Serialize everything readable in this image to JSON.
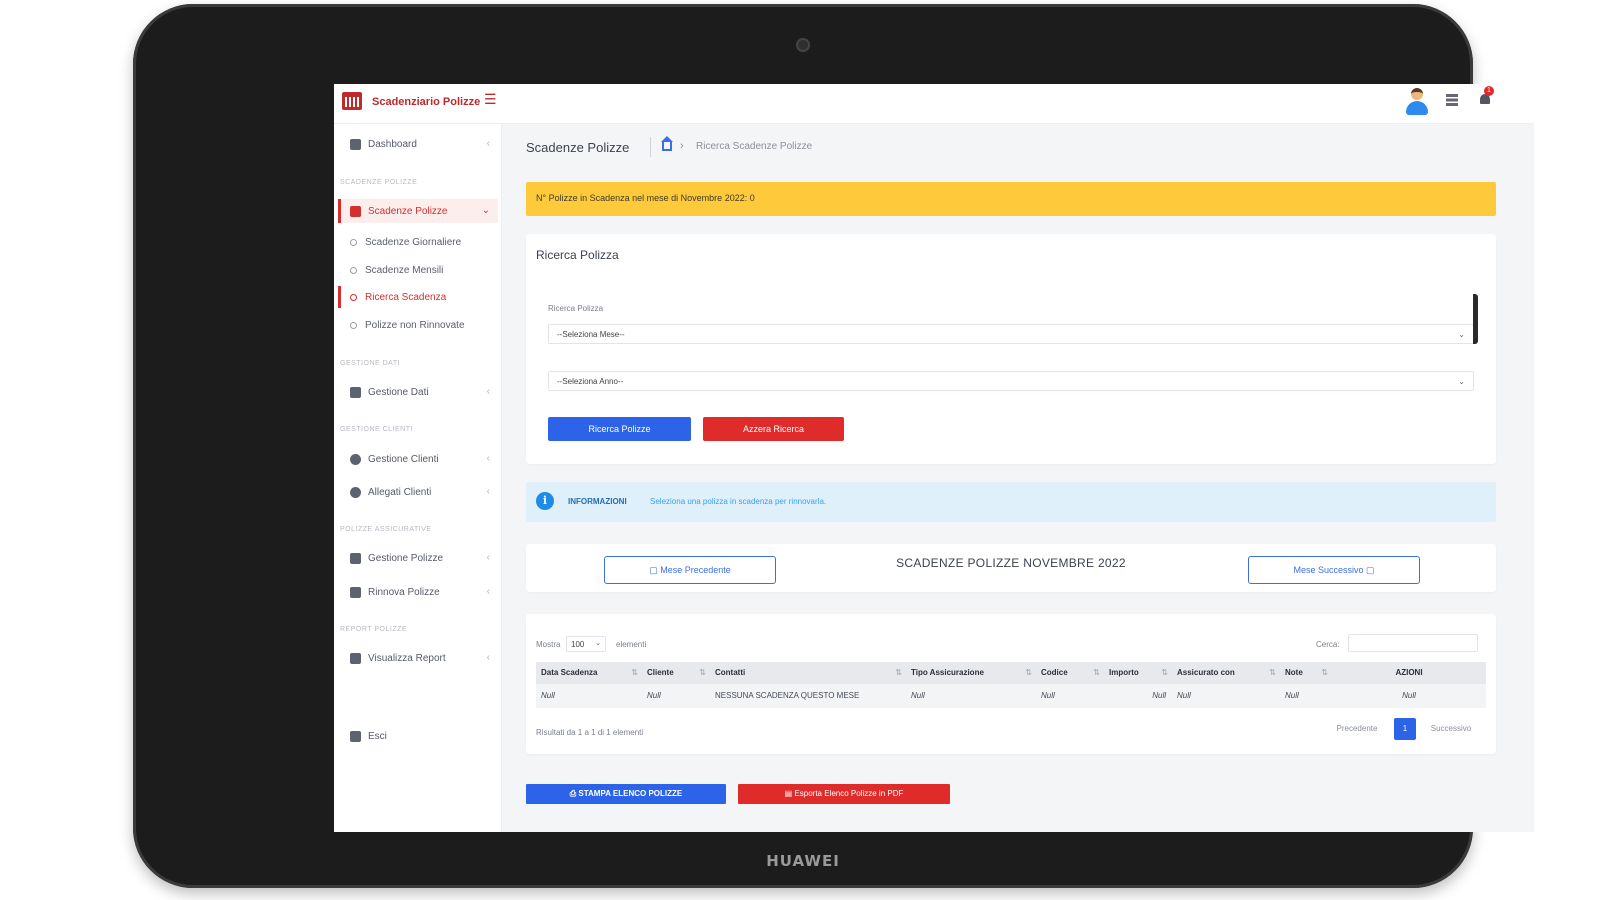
{
  "device": {
    "brand": "HUAWEI"
  },
  "topbar": {
    "app_title": "Scadenziario Polizze",
    "menu_icon": "hamburger-icon",
    "user_icon": "user-avatar-icon",
    "apps_icon": "grid-icon",
    "notifications_icon": "bell-icon",
    "notifications_count": "1"
  },
  "sidebar": {
    "dashboard": "Dashboard",
    "section_scadenze": "SCADENZE POLIZZE",
    "scadenze_polizze": "Scadenze Polizze",
    "sub_items": [
      "Scadenze Giornaliere",
      "Scadenze Mensili",
      "Ricerca Scadenza",
      "Polizze non Rinnovate"
    ],
    "active_sub": "Ricerca Scadenza",
    "section_dati": "GESTIONE DATI",
    "gestione_dati": "Gestione Dati",
    "section_clienti": "GESTIONE CLIENTI",
    "gestione_clienti": "Gestione Clienti",
    "allegati_clienti": "Allegati Clienti",
    "section_polizze": "POLIZZE ASSICURATIVE",
    "gestione_polizze": "Gestione Polizze",
    "rinnova_polizze": "Rinnova Polizze",
    "section_report": "REPORT POLIZZE",
    "visualizza_report": "Visualizza Report",
    "esci": "Esci"
  },
  "header": {
    "page_title": "Scadenze Polizze",
    "breadcrumb_current": "Ricerca Scadenze Polizze"
  },
  "alert_count": {
    "text": "N° Polizze in Scadenza nel mese di Novembre 2022: 0"
  },
  "search_card": {
    "title": "Ricerca Polizza",
    "field_label": "Ricerca Polizza",
    "month_select": "--Seleziona Mese--",
    "year_select": "--Seleziona Anno--",
    "search_button": "Ricerca Polizze",
    "reset_button": "Azzera Ricerca"
  },
  "info_alert": {
    "label": "INFORMAZIONI",
    "text": "Seleziona una polizza in scadenza per rinnovarla."
  },
  "month_nav": {
    "prev_button": "Mese Precedente",
    "title": "SCADENZE POLIZZE NOVEMBRE 2022",
    "next_button": "Mese Successivo"
  },
  "table": {
    "show_label": "Mostra",
    "page_length": "100",
    "entries_label": "elementi",
    "search_label": "Cerca:",
    "columns": [
      "Data Scadenza",
      "Cliente",
      "Contatti",
      "Tipo Assicurazione",
      "Codice",
      "Importo",
      "Assicurato con",
      "Note",
      "AZIONI"
    ],
    "rows": [
      [
        "Null",
        "Null",
        "NESSUNA SCADENZA QUESTO MESE",
        "Null",
        "Null",
        "Null",
        "Null",
        "Null",
        "Null"
      ]
    ],
    "info": "Risultati da 1 a 1 di 1 elementi",
    "prev_page": "Precedente",
    "current_page": "1",
    "next_page": "Successivo"
  },
  "actions": {
    "print_button": "STAMPA ELENCO POLIZZE",
    "export_button": "Esporta Elenco Polizze in PDF"
  }
}
